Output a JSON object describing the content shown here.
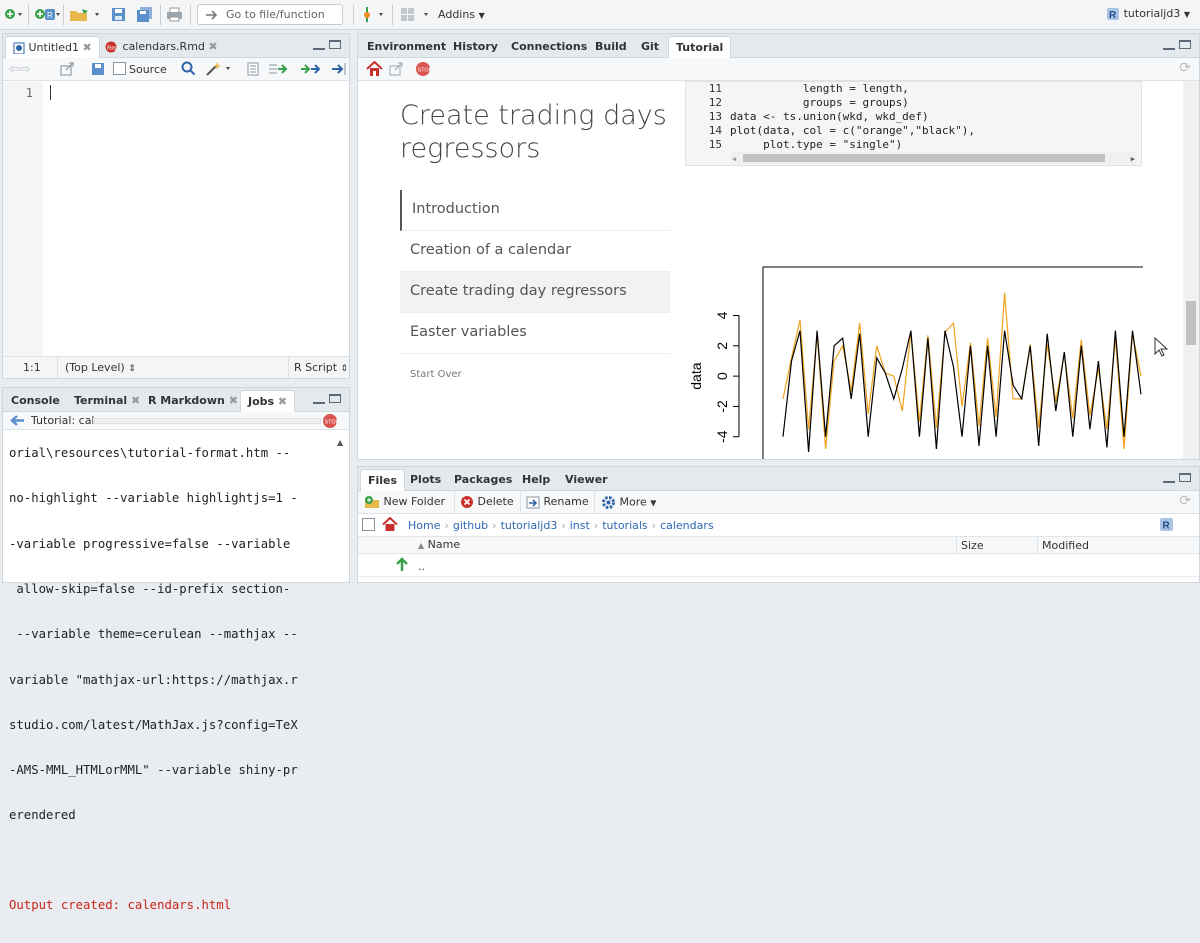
{
  "toolbar": {
    "goto_placeholder": "Go to file/function",
    "addins_label": "Addins",
    "project_name": "tutorialjd3"
  },
  "editor": {
    "tabs": [
      "Untitled1",
      "calendars.Rmd"
    ],
    "source_label": "Source",
    "line_number": "1",
    "status_position": "1:1",
    "status_scope": "(Top Level)",
    "status_type": "R Script"
  },
  "console": {
    "tabs": [
      "Console",
      "Terminal",
      "R Markdown",
      "Jobs"
    ],
    "job_label": "Tutorial: cal...",
    "lines": [
      "orial\\resources\\tutorial-format.htm --",
      "no-highlight --variable highlightjs=1 -",
      "-variable progressive=false --variable",
      " allow-skip=false --id-prefix section-",
      " --variable theme=cerulean --mathjax --",
      "variable \"mathjax-url:https://mathjax.r",
      "studio.com/latest/MathJax.js?config=TeX",
      "-AMS-MML_HTMLorMML\" --variable shiny-pr",
      "erendered"
    ],
    "output_line": "Output created: calendars.html"
  },
  "tutorial_pane": {
    "tabs": [
      "Environment",
      "History",
      "Connections",
      "Build",
      "Git",
      "Tutorial"
    ],
    "title_line1": "Create trading days",
    "title_line2": "regressors",
    "toc": [
      "Introduction",
      "Creation of a calendar",
      "Create trading day regressors",
      "Easter variables"
    ],
    "start_over": "Start Over",
    "code_lines": [
      {
        "n": "11",
        "code": "           length = length,"
      },
      {
        "n": "12",
        "code": "           groups = groups)"
      },
      {
        "n": "13",
        "code": "data <- ts.union(wkd, wkd_def)"
      },
      {
        "n": "14",
        "code": "plot(data, col = c(\"orange\",\"black\"),"
      },
      {
        "n": "15",
        "code": "     plot.type = \"single\")"
      }
    ]
  },
  "chart_data": {
    "type": "line",
    "ylabel": "data",
    "yticks": [
      "4",
      "2",
      "0",
      "-2",
      "-4"
    ],
    "ylim": [
      -5.6,
      7.2
    ],
    "series": [
      {
        "color": "#f0a31f",
        "values": [
          -1.5,
          1.2,
          3.7,
          -3.5,
          2.8,
          -4.8,
          1.0,
          2.0,
          -1.0,
          3.5,
          -2.5,
          2.0,
          0.2,
          0.0,
          -2.3,
          2.9,
          -3.0,
          2.7,
          -3.4,
          2.9,
          3.5,
          -2.0,
          2.2,
          -3.3,
          2.5,
          -2.7,
          5.5,
          -1.5,
          -1.5,
          2.1,
          -3.4,
          2.1,
          -1.7,
          1.5,
          -2.8,
          2.4,
          -2.6,
          0.5,
          -3.5,
          2.5,
          -4.8,
          2.8,
          0.0
        ]
      },
      {
        "color": "#000000",
        "values": [
          -4.0,
          1.0,
          3.0,
          -5.0,
          3.0,
          -4.0,
          2.0,
          2.5,
          -1.5,
          2.8,
          -4.0,
          1.2,
          0.2,
          -1.5,
          0.5,
          3.0,
          -4.0,
          2.5,
          -4.8,
          3.0,
          0.6,
          -4.0,
          2.0,
          -4.6,
          2.0,
          -4.0,
          3.0,
          -0.6,
          -1.5,
          2.0,
          -4.6,
          2.8,
          -2.3,
          1.6,
          -4.0,
          2.0,
          -3.5,
          1.0,
          -4.7,
          3.0,
          -4.0,
          3.0,
          -1.2
        ]
      }
    ]
  },
  "files_pane": {
    "tabs": [
      "Files",
      "Plots",
      "Packages",
      "Help",
      "Viewer"
    ],
    "new_folder": "New Folder",
    "delete": "Delete",
    "rename": "Rename",
    "more": "More",
    "breadcrumb": [
      "Home",
      "github",
      "tutorialjd3",
      "inst",
      "tutorials",
      "calendars"
    ],
    "col_name": "Name",
    "col_size": "Size",
    "col_modified": "Modified",
    "parent_dir": ".."
  }
}
